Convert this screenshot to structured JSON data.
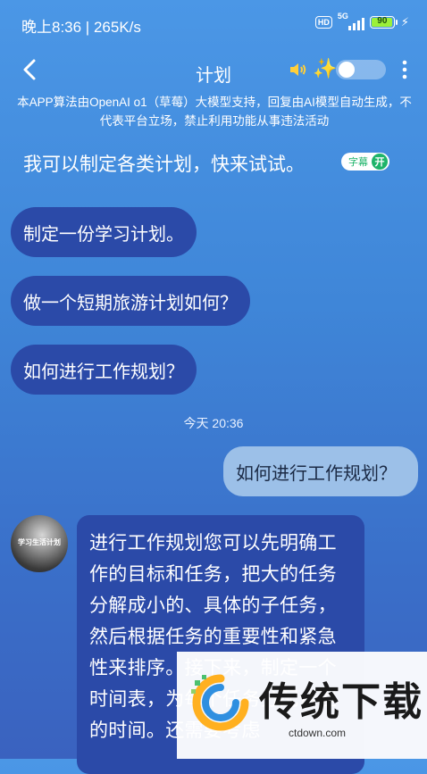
{
  "status_bar": {
    "time": "晚上8:36 | 265K/s",
    "hd_badge": "HD",
    "network": "5G",
    "battery": "90"
  },
  "header": {
    "title": "计划"
  },
  "disclaimer": "本APP算法由OpenAI o1（草莓）大模型支持，回复由AI模型自动生成，不代表平台立场，禁止利用功能从事违法活动",
  "intro": {
    "text": "我可以制定各类计划，快来试试。",
    "subtitle_label": "字幕",
    "subtitle_state": "开"
  },
  "suggestions": [
    "制定一份学习计划。",
    "做一个短期旅游计划如何？",
    "如何进行工作规划？"
  ],
  "chat": {
    "timestamp": "今天 20:36",
    "user_message": "如何进行工作规划？",
    "bot_avatar_label": "学习生活计划",
    "bot_message": "进行工作规划您可以先明确工作的目标和任务，把大的任务分解成小的、具体的子任务，然后根据任务的重要性和紧急性来排序。接下来，制定一个时间表，为每个任务分配合理的时间。还需要考虑"
  },
  "watermark": {
    "title": "传统下载",
    "url": "ctdown.com"
  },
  "colors": {
    "bubble": "#2b4aa8",
    "user_bubble": "#9cc0e8",
    "accent_green": "#1eb46a",
    "sparkle": "#ffd84a"
  }
}
